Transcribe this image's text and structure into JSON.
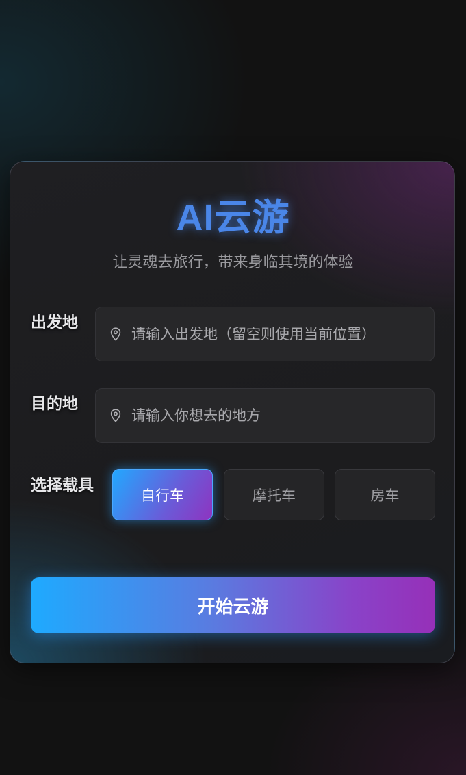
{
  "app": {
    "title": "AI云游",
    "subtitle": "让灵魂去旅行，带来身临其境的体验"
  },
  "origin": {
    "label": "出发地",
    "placeholder": "请输入出发地（留空则使用当前位置）",
    "value": "",
    "icon": "location-pin-icon"
  },
  "destination": {
    "label": "目的地",
    "placeholder": "请输入你想去的地方",
    "value": "",
    "icon": "location-pin-icon"
  },
  "vehicle": {
    "label": "选择载具",
    "selected": "自行车",
    "options": [
      {
        "label": "自行车",
        "active": true
      },
      {
        "label": "摩托车",
        "active": false
      },
      {
        "label": "房车",
        "active": false
      }
    ]
  },
  "start_button": {
    "label": "开始云游"
  },
  "colors": {
    "accent_blue": "#4a86e8",
    "gradient_start": "#1eaaff",
    "gradient_end": "#9630b8",
    "background": "#121212"
  }
}
